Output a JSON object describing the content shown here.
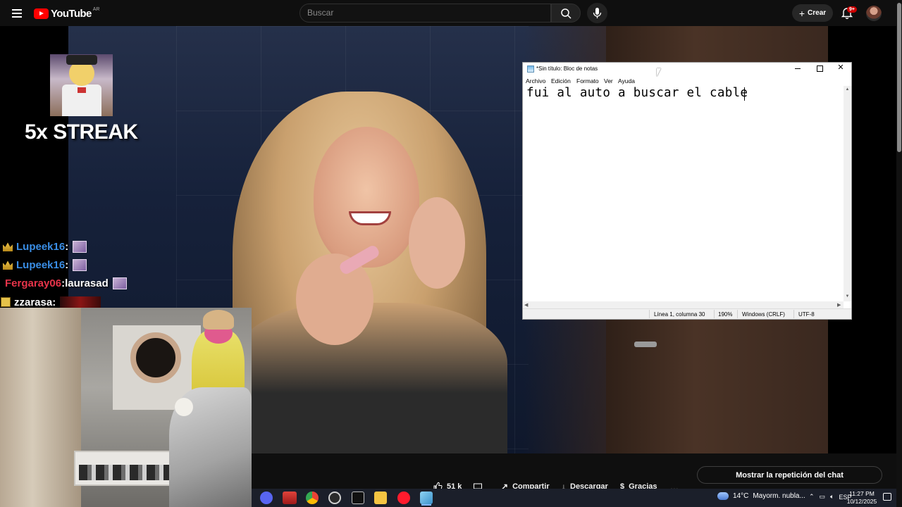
{
  "youtube": {
    "logo_text": "YouTube",
    "region": "AR",
    "search_placeholder": "Buscar",
    "create_label": "Crear",
    "notifications_badge": "9+"
  },
  "overlay": {
    "streak_text": "5x STREAK",
    "chat": [
      {
        "user": "Lupeek16",
        "sep": " :",
        "message": "",
        "user_color": "#3a8ee6"
      },
      {
        "user": "Lupeek16",
        "sep": " :",
        "message": "",
        "user_color": "#3a8ee6"
      },
      {
        "user": "Fergaray06",
        "sep": " :",
        "message": " laurasad",
        "user_color": "#e8344a"
      },
      {
        "user": "zzarasa",
        "sep": " :",
        "message": "",
        "user_color": "#ffffff"
      }
    ]
  },
  "actions": {
    "likes": "51 k",
    "share": "Compartir",
    "download": "Descargar",
    "thanks": "Gracias",
    "more": "...",
    "chat_replay": "Mostrar la repetición del chat"
  },
  "notepad": {
    "title": "*Sin título: Bloc de notas",
    "menus": [
      "Archivo",
      "Edición",
      "Formato",
      "Ver",
      "Ayuda"
    ],
    "content": "fui al auto a buscar el cable",
    "status": {
      "position": "Línea 1, columna 30",
      "zoom": "190%",
      "line_endings": "Windows (CRLF)",
      "encoding": "UTF-8"
    },
    "close_glyph": "✕"
  },
  "taskbar": {
    "weather_temp": "14°C",
    "weather_desc": "Mayorm. nubla...",
    "language": "ESP",
    "time": "11:27 PM",
    "date": "10/12/2025"
  },
  "colors": {
    "youtube_red": "#ff0000",
    "taskbar_bg": "#1b1f2a",
    "notepad_bg": "#ffffff"
  }
}
